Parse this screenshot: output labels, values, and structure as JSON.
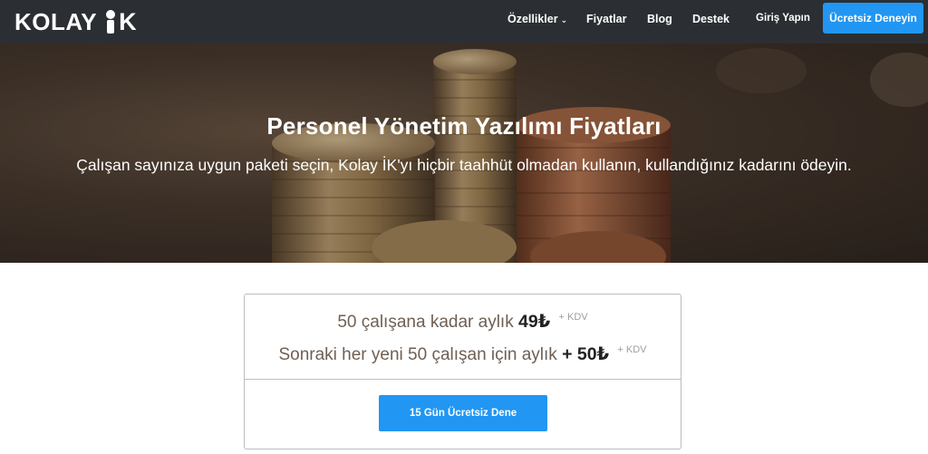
{
  "brand": {
    "name": "KOLAY",
    "suffix": "K"
  },
  "nav": {
    "items": [
      {
        "label": "Özellikler",
        "has_dropdown": true
      },
      {
        "label": "Fiyatlar"
      },
      {
        "label": "Blog"
      },
      {
        "label": "Destek"
      },
      {
        "label": "Giriş Yapın"
      }
    ],
    "cta_label": "Ücretsiz Deneyin"
  },
  "hero": {
    "title": "Personel Yönetim Yazılımı Fiyatları",
    "subtitle": "Çalışan sayınıza uygun paketi seçin, Kolay İK'yı hiçbir taahhüt olmadan kullanın, kullandığınız kadarını ödeyin."
  },
  "pricing": {
    "line1_text": "50 çalışana kadar aylık",
    "line1_amount": "49₺",
    "line1_tax": "+ KDV",
    "line2_text": "Sonraki her yeni 50 çalışan için aylık",
    "line2_amount": "+ 50₺",
    "line2_tax": "+ KDV",
    "cta_label": "15 Gün Ücretsiz Dene"
  },
  "colors": {
    "nav_bg": "#2b2f33",
    "accent": "#2196f3",
    "price_text": "#6f5f53"
  }
}
